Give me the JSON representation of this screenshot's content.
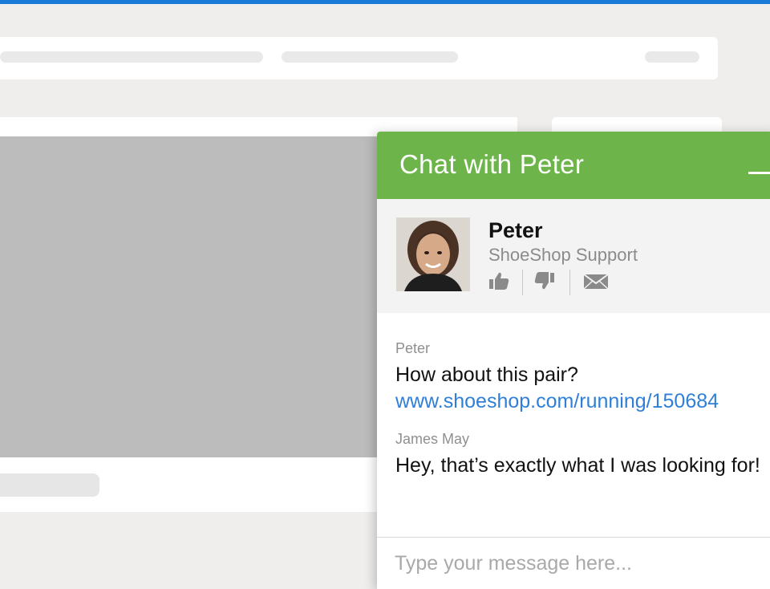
{
  "colors": {
    "topbar": "#1a7ad8",
    "chat_header": "#6db54a",
    "link": "#2f7fd8"
  },
  "chat": {
    "title": "Chat with Peter",
    "minimize_icon": "minimize-icon",
    "agent": {
      "name": "Peter",
      "organization": "ShoeShop Support",
      "actions": [
        {
          "icon": "thumbs-up-icon"
        },
        {
          "icon": "thumbs-down-icon"
        },
        {
          "icon": "envelope-icon"
        }
      ]
    },
    "messages": [
      {
        "author": "Peter",
        "text": "How about this pair?",
        "link": "www.shoeshop.com/running/150684"
      },
      {
        "author": "James May",
        "text": "Hey, that’s exactly what I was looking for!"
      }
    ],
    "input": {
      "placeholder": "Type your message here...",
      "value": ""
    }
  }
}
